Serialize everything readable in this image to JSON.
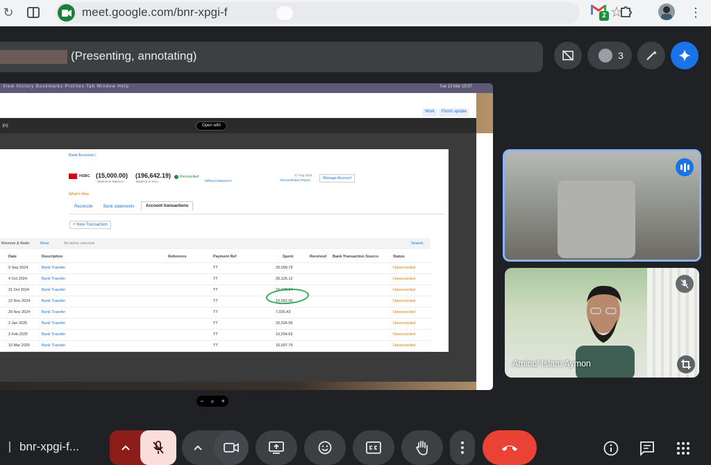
{
  "browser": {
    "url": "meet.google.com/bnr-xpgi-f",
    "gmail_badge": "2"
  },
  "meet": {
    "presenter_status": "(Presenting, annotating)",
    "participant_count": "3",
    "meeting_code": "bnr-xpgi-f...",
    "participants": [
      {
        "name": "",
        "speaking": true
      },
      {
        "name": "Aminul Islam Aymon",
        "muted": true
      }
    ]
  },
  "shared_screen": {
    "mac_menu": "View   History   Bookmarks   Profiles   Tab   Window   Help",
    "mac_status": "Tue 13 Mar  15:07",
    "tab_work": "Work",
    "tab_finish": "Finish update",
    "file_ext": ".jpg",
    "open_with": "Open with",
    "breadcrumb": "Bank Accounts /",
    "bank": "HSBC",
    "statement_balance": "(15,000.00)",
    "statement_label": "Statement Balance",
    "xero_balance": "(196,642.19)",
    "xero_label": "Balance in Xero",
    "reconciled_label": "Reconciled",
    "difference_label": "Different balances?",
    "report_date": "27 Aug 2025",
    "report_label": "Reconciliation Report",
    "manage_account": "Manage Account",
    "whats_new": "What's New",
    "tabs": [
      "Reconcile",
      "Bank statements",
      "Account transactions"
    ],
    "new_transaction": "+ New Transaction",
    "filter_remove": "Remove & Redo",
    "filter_more": "More",
    "filter_none": "No items selected",
    "search": "Search",
    "columns": [
      "Date",
      "Description",
      "Reference",
      "Payment Ref",
      "Spent",
      "Received",
      "Bank Transaction Source",
      "Status"
    ],
    "rows": [
      {
        "date": "9 Sep 2024",
        "desc": "Bank Transfer",
        "ref": "TT",
        "spent": "20,099.79",
        "status": "Unreconciled"
      },
      {
        "date": "4 Oct 2024",
        "desc": "Bank Transfer",
        "ref": "TT",
        "spent": "30,126.12",
        "status": "Unreconciled"
      },
      {
        "date": "21 Oct 2024",
        "desc": "Bank Transfer",
        "ref": "TT",
        "spent": "10,042.04",
        "status": "Unreconciled"
      },
      {
        "date": "22 Nov 2024",
        "desc": "Bank Transfer",
        "ref": "TT",
        "spent": "10,062.05",
        "status": "Unreconciled"
      },
      {
        "date": "29 Nov 2024",
        "desc": "Bank Transfer",
        "ref": "TT",
        "spent": "7,026.43",
        "status": "Unreconciled"
      },
      {
        "date": "2 Jan 2025",
        "desc": "Bank Transfer",
        "ref": "TT",
        "spent": "20,324.09",
        "status": "Unreconciled"
      },
      {
        "date": "3 Feb 2025",
        "desc": "Bank Transfer",
        "ref": "TT",
        "spent": "10,254.63",
        "status": "Unreconciled"
      },
      {
        "date": "10 Mar 2025",
        "desc": "Bank Transfer",
        "ref": "TT",
        "spent": "10,007.79",
        "status": "Unreconciled"
      }
    ]
  },
  "colors": {
    "meet_bg": "#202124",
    "control_bg": "#3c4043",
    "hangup": "#ea4335",
    "mic_off_bg": "#f9dedc",
    "mic_group": "#8c1d18",
    "active_border": "#8ab4f8",
    "annotation": "#2eaa55"
  }
}
